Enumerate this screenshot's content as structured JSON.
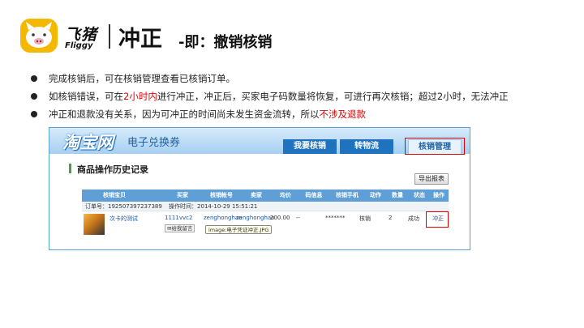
{
  "brand": {
    "name_cn": "飞猪",
    "name_en": "Fliggy",
    "icon": "pig-logo-icon",
    "colors": {
      "logo_yellow": "#f5b800",
      "accent_red": "#e00000"
    }
  },
  "title": {
    "main": "冲正",
    "sub": "-即：撤销核销"
  },
  "bullets": [
    {
      "text": "完成核销后，可在核销管理查看已核销订单。"
    },
    {
      "before": "如核销错误，可在",
      "highlight": "2小时内",
      "after": "进行冲正，冲正后，买家电子码数量将恢复，可进行再次核销；超过2小时，无法冲正"
    },
    {
      "before": "冲正和退款没有关系，因为可冲正的时间尚未发生资金流转，所以",
      "highlight": "不涉及退款"
    }
  ],
  "screenshot": {
    "logo": "淘宝网",
    "subtitle": "电子兑换券",
    "tabs": [
      "我要核销",
      "转物流",
      "核销管理"
    ],
    "active_tab": "核销管理",
    "section_title": "商品操作历史记录",
    "export_label": "导出报表",
    "columns": [
      "核销宝贝",
      "买家",
      "核销帐号",
      "卖家",
      "均价",
      "码信息",
      "核销手机",
      "动作",
      "数量",
      "状态",
      "操作"
    ],
    "order": {
      "id": "订单号：192507397237389",
      "time": "操作时间：2014-10-29 15:51:21"
    },
    "row": {
      "item": "次卡的测试",
      "buyer": "1111vvc2",
      "buyer_message": "给我留言",
      "account": "zenghonghao",
      "seller": "zenghonghao",
      "price": "200.00",
      "code_info": "--",
      "phone": "*******",
      "action": "核销",
      "qty": "2",
      "status": "成功",
      "op": "冲正",
      "tooltip": "image:电子凭证冲正.JPG"
    }
  }
}
